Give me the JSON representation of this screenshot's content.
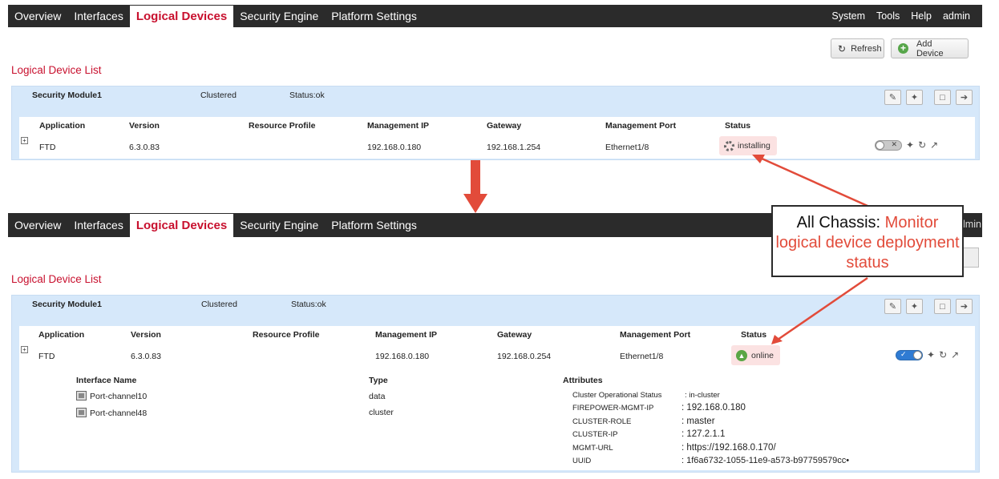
{
  "top": {
    "nav": {
      "left": [
        "Overview",
        "Interfaces",
        "Logical Devices",
        "Security Engine",
        "Platform Settings"
      ],
      "right": [
        "System",
        "Tools",
        "Help",
        "admin"
      ],
      "active": "Logical Devices"
    },
    "toolbar": {
      "refresh_label": "Refresh",
      "add_device_label": "Add Device"
    },
    "section_title": "Logical Device List",
    "module": {
      "name": "Security Module1",
      "mode": "Clustered",
      "status": "Status:ok"
    },
    "columns": [
      "Application",
      "Version",
      "Resource Profile",
      "Management IP",
      "Gateway",
      "Management Port",
      "Status"
    ],
    "row": {
      "application": "FTD",
      "version": "6.3.0.83",
      "resource_profile": "",
      "management_ip": "192.168.0.180",
      "gateway": "192.168.1.254",
      "management_port": "Ethernet1/8",
      "status": "installing"
    }
  },
  "bottom": {
    "nav": {
      "left": [
        "Overview",
        "Interfaces",
        "Logical Devices",
        "Security Engine",
        "Platform Settings"
      ],
      "admin_fragment": "lmin",
      "active": "Logical Devices"
    },
    "section_title": "Logical Device List",
    "module": {
      "name": "Security Module1",
      "mode": "Clustered",
      "status": "Status:ok"
    },
    "columns": [
      "Application",
      "Version",
      "Resource Profile",
      "Management IP",
      "Gateway",
      "Management Port",
      "Status"
    ],
    "row": {
      "application": "FTD",
      "version": "6.3.0.83",
      "resource_profile": "",
      "management_ip": "192.168.0.180",
      "gateway": "192.168.0.254",
      "management_port": "Ethernet1/8",
      "status": "online"
    },
    "detail": {
      "interface_header": "Interface Name",
      "type_header": "Type",
      "attributes_header": "Attributes",
      "interfaces": [
        {
          "name": "Port-channel10",
          "type": "data"
        },
        {
          "name": "Port-channel48",
          "type": "cluster"
        }
      ],
      "attributes": [
        {
          "key": "Cluster Operational Status",
          "value": ": in-cluster"
        },
        {
          "key": "FIREPOWER-MGMT-IP",
          "value": ": 192.168.0.180"
        },
        {
          "key": "CLUSTER-ROLE",
          "value": ": master"
        },
        {
          "key": "CLUSTER-IP",
          "value": ": 127.2.1.1"
        },
        {
          "key": "MGMT-URL",
          "value": ": https://192.168.0.170/"
        },
        {
          "key": "UUID",
          "value": ": 1f6a6732-1055-11e9-a573-b97759579cc•"
        }
      ]
    }
  },
  "callout": {
    "lead": "All Chassis",
    "separator": ":",
    "text": "Monitor logical device deployment status"
  },
  "colors": {
    "navbar": "#2b2b2b",
    "active_tab_text": "#c8102e",
    "panel": "#d6e8fa",
    "status_pill": "#fbe2e2",
    "arrow": "#e24b3a"
  }
}
